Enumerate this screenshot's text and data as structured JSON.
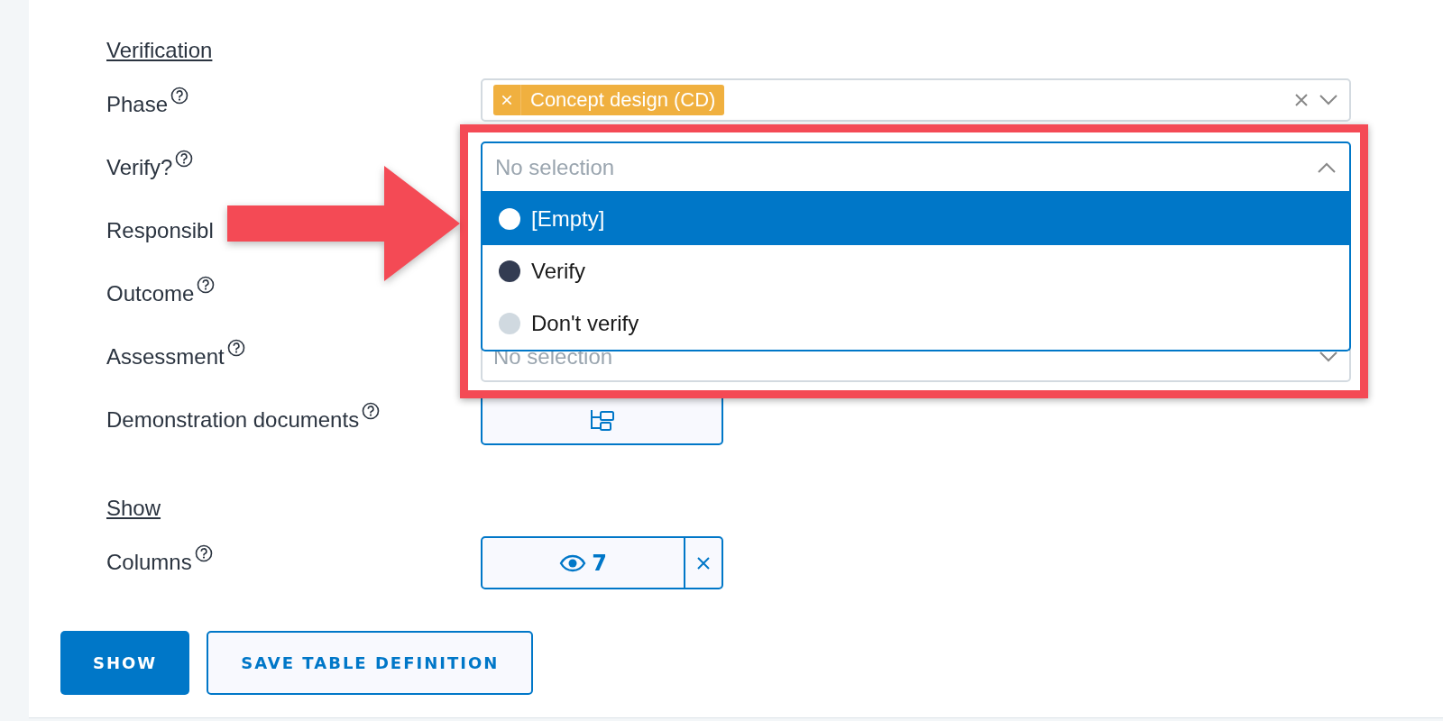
{
  "sections": [
    {
      "heading": "Verification",
      "fields": [
        {
          "label": "Phase",
          "help": true,
          "kind": "multiselect",
          "tags": [
            {
              "label": "Concept design (CD)"
            }
          ]
        },
        {
          "label": "Verify?",
          "help": true,
          "kind": "select",
          "placeholder": "No selection",
          "expanded": true,
          "options": [
            {
              "label": "[Empty]",
              "color": "#ffffff",
              "selected": true
            },
            {
              "label": "Verify",
              "color": "#333c52",
              "selected": false
            },
            {
              "label": "Don't verify",
              "color": "#d0d9e0",
              "selected": false
            }
          ]
        },
        {
          "label": "Responsibl",
          "kind": "covered"
        },
        {
          "label": "Outcome",
          "help": true,
          "kind": "covered"
        },
        {
          "label": "Assessment",
          "help": true,
          "kind": "select",
          "placeholder": "No selection",
          "expanded": false
        },
        {
          "label": "Demonstration documents",
          "help": true,
          "kind": "tree-button"
        }
      ]
    },
    {
      "heading": "Show",
      "fields": [
        {
          "label": "Columns",
          "help": true,
          "kind": "columns",
          "count": "7"
        }
      ]
    }
  ],
  "buttons": [
    {
      "label": "SHOW",
      "kind": "primary"
    },
    {
      "label": "SAVE TABLE DEFINITION",
      "kind": "secondary"
    }
  ]
}
